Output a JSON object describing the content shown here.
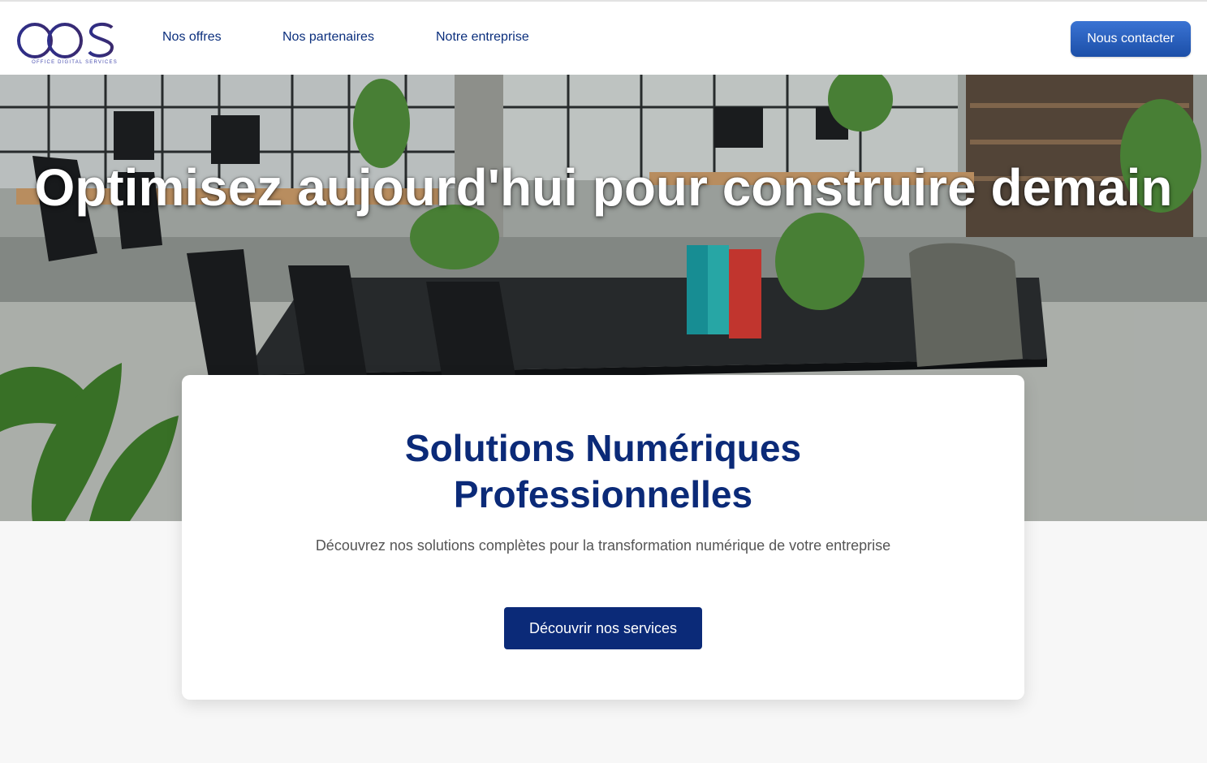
{
  "header": {
    "logo_text": "ods",
    "logo_tagline": "OFFICE DIGITAL SERVICES",
    "nav": [
      {
        "label": "Nos offres"
      },
      {
        "label": "Nos partenaires"
      },
      {
        "label": "Notre entreprise"
      }
    ],
    "contact_label": "Nous contacter"
  },
  "hero": {
    "title": "Optimisez aujourd'hui pour construire demain"
  },
  "card": {
    "title_line1": "Solutions Numériques",
    "title_line2": "Professionnelles",
    "description": "Découvrez nos solutions complètes pour la transformation numérique de votre entreprise",
    "cta_label": "Découvrir nos services"
  },
  "colors": {
    "brand_navy": "#0b2a78",
    "nav_text": "#0b2f7d",
    "contact_button": "#2a63c4",
    "page_background": "#f7f7f7"
  }
}
